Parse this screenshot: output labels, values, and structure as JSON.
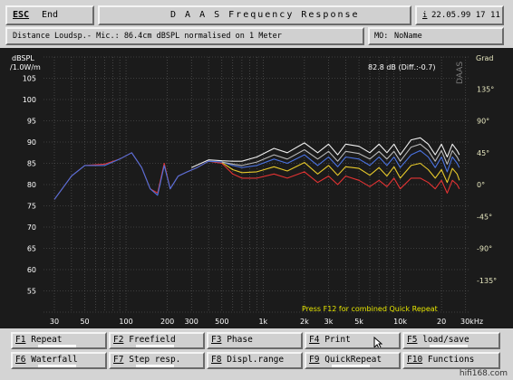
{
  "header": {
    "esc_key": "ESC",
    "esc_label": "End",
    "title": "D A A S   Frequency Response",
    "info_icon": "i",
    "datetime": "22.05.99 17 11"
  },
  "subheader": {
    "description": "Distance Loudsp.- Mic.: 86.4cm dBSPL normalised on 1 Meter",
    "mo_label": "MO:",
    "mo_value": "NoName"
  },
  "plot": {
    "readout": "82.8 dB (Diff.:-0.7)",
    "brand_vertical": "DAAS",
    "hint": "Press F12 for combined Quick Repeat",
    "left_unit_1": "dBSPL",
    "left_unit_2": "/1.0W/m",
    "right_unit": "Grad",
    "x_unit": "30kHz",
    "colors": {
      "background": "#1b1b1b",
      "grid": "#606060",
      "axis_text": "#ffffff",
      "right_axis_text": "#e8e8c0",
      "hint_text": "#e6e600"
    }
  },
  "chart_data": {
    "type": "line",
    "xscale": "log",
    "xlim": [
      25,
      32000
    ],
    "ylim": [
      50,
      110
    ],
    "y2lim": [
      -180,
      180
    ],
    "grid": true,
    "x_ticks": [
      {
        "value": 30,
        "label": "30"
      },
      {
        "value": 50,
        "label": "50"
      },
      {
        "value": 100,
        "label": "100"
      },
      {
        "value": 200,
        "label": "200"
      },
      {
        "value": 300,
        "label": "300"
      },
      {
        "value": 500,
        "label": "500"
      },
      {
        "value": 1000,
        "label": "1k"
      },
      {
        "value": 2000,
        "label": "2k"
      },
      {
        "value": 3000,
        "label": "3k"
      },
      {
        "value": 5000,
        "label": "5k"
      },
      {
        "value": 10000,
        "label": "10k"
      },
      {
        "value": 20000,
        "label": "20"
      }
    ],
    "y_ticks": [
      55,
      60,
      65,
      70,
      75,
      80,
      85,
      90,
      95,
      100,
      105
    ],
    "y2_ticks": [
      {
        "value": 135,
        "label": "135°"
      },
      {
        "value": 90,
        "label": "90°"
      },
      {
        "value": 45,
        "label": "45°"
      },
      {
        "value": 0,
        "label": "0°"
      },
      {
        "value": -45,
        "label": "-45°"
      },
      {
        "value": -90,
        "label": "-90°"
      },
      {
        "value": -135,
        "label": "-135°"
      }
    ],
    "series": [
      {
        "color": "#e33333",
        "points": [
          [
            30,
            76.5
          ],
          [
            40,
            82
          ],
          [
            50,
            84.5
          ],
          [
            70,
            84.8
          ],
          [
            90,
            86
          ],
          [
            110,
            87.5
          ],
          [
            130,
            84
          ],
          [
            150,
            79
          ],
          [
            170,
            78
          ],
          [
            190,
            85
          ],
          [
            210,
            79
          ],
          [
            240,
            82
          ],
          [
            280,
            83
          ],
          [
            330,
            84
          ],
          [
            400,
            85.5
          ],
          [
            500,
            85
          ],
          [
            600,
            82.5
          ],
          [
            700,
            81.5
          ],
          [
            900,
            81.5
          ],
          [
            1200,
            82.5
          ],
          [
            1500,
            81.5
          ],
          [
            2000,
            83
          ],
          [
            2500,
            80.5
          ],
          [
            3000,
            82
          ],
          [
            3500,
            80
          ],
          [
            4000,
            82
          ],
          [
            5000,
            81
          ],
          [
            6000,
            79.5
          ],
          [
            7000,
            81
          ],
          [
            8000,
            79.5
          ],
          [
            9000,
            81.5
          ],
          [
            10000,
            79
          ],
          [
            12000,
            81.5
          ],
          [
            14000,
            81.5
          ],
          [
            16000,
            80.5
          ],
          [
            18000,
            79
          ],
          [
            20000,
            81
          ],
          [
            22000,
            78
          ],
          [
            24000,
            81
          ],
          [
            26000,
            80
          ],
          [
            27000,
            79
          ]
        ]
      },
      {
        "color": "#e6c82a",
        "points": [
          [
            500,
            85.2
          ],
          [
            600,
            83.5
          ],
          [
            700,
            82.8
          ],
          [
            900,
            83
          ],
          [
            1200,
            84.2
          ],
          [
            1500,
            83.2
          ],
          [
            2000,
            85.2
          ],
          [
            2500,
            82.5
          ],
          [
            3000,
            84.5
          ],
          [
            3500,
            82.2
          ],
          [
            4000,
            84.2
          ],
          [
            5000,
            83.8
          ],
          [
            6000,
            82.2
          ],
          [
            7000,
            84
          ],
          [
            8000,
            82
          ],
          [
            9000,
            84.2
          ],
          [
            10000,
            81.5
          ],
          [
            12000,
            84.5
          ],
          [
            14000,
            85
          ],
          [
            16000,
            83.5
          ],
          [
            18000,
            81.5
          ],
          [
            20000,
            83.5
          ],
          [
            22000,
            80.5
          ],
          [
            24000,
            83.8
          ],
          [
            26000,
            82.5
          ],
          [
            27000,
            81
          ]
        ]
      },
      {
        "color": "#4a72e0",
        "points": [
          [
            30,
            76.5
          ],
          [
            40,
            82
          ],
          [
            50,
            84.5
          ],
          [
            70,
            84.5
          ],
          [
            90,
            86
          ],
          [
            110,
            87.5
          ],
          [
            130,
            84
          ],
          [
            150,
            79
          ],
          [
            170,
            77.5
          ],
          [
            190,
            84.5
          ],
          [
            210,
            79
          ],
          [
            240,
            82
          ],
          [
            280,
            83
          ],
          [
            330,
            84
          ],
          [
            400,
            85.5
          ],
          [
            500,
            85.3
          ],
          [
            600,
            84.5
          ],
          [
            700,
            84
          ],
          [
            900,
            84.5
          ],
          [
            1200,
            86
          ],
          [
            1500,
            85
          ],
          [
            2000,
            87
          ],
          [
            2500,
            84.5
          ],
          [
            3000,
            86.5
          ],
          [
            3500,
            84.2
          ],
          [
            4000,
            86.5
          ],
          [
            5000,
            86
          ],
          [
            6000,
            84.5
          ],
          [
            7000,
            86.5
          ],
          [
            8000,
            84.5
          ],
          [
            9000,
            86.5
          ],
          [
            10000,
            84
          ],
          [
            12000,
            87
          ],
          [
            14000,
            88
          ],
          [
            16000,
            86.5
          ],
          [
            18000,
            84
          ],
          [
            20000,
            86.5
          ],
          [
            22000,
            83
          ],
          [
            24000,
            86.5
          ],
          [
            26000,
            85
          ],
          [
            27000,
            84
          ]
        ]
      },
      {
        "color": "#f0f0f0",
        "points": [
          [
            300,
            84
          ],
          [
            400,
            85.8
          ],
          [
            500,
            85.6
          ],
          [
            600,
            85.5
          ],
          [
            700,
            85.5
          ],
          [
            900,
            86.5
          ],
          [
            1200,
            88.5
          ],
          [
            1500,
            87.5
          ],
          [
            2000,
            89.8
          ],
          [
            2500,
            87.5
          ],
          [
            3000,
            89.5
          ],
          [
            3500,
            87
          ],
          [
            4000,
            89.5
          ],
          [
            5000,
            89
          ],
          [
            6000,
            87.5
          ],
          [
            7000,
            89.5
          ],
          [
            8000,
            87.5
          ],
          [
            9000,
            89.5
          ],
          [
            10000,
            87
          ],
          [
            12000,
            90.5
          ],
          [
            14000,
            91
          ],
          [
            16000,
            89.5
          ],
          [
            18000,
            87
          ],
          [
            20000,
            89.5
          ],
          [
            22000,
            86.5
          ],
          [
            24000,
            89.5
          ],
          [
            26000,
            88
          ],
          [
            27000,
            87
          ]
        ]
      },
      {
        "color": "#b8b8b8",
        "points": [
          [
            500,
            85.3
          ],
          [
            600,
            84.8
          ],
          [
            700,
            84.5
          ],
          [
            900,
            85.3
          ],
          [
            1200,
            87
          ],
          [
            1500,
            86
          ],
          [
            2000,
            88.2
          ],
          [
            2500,
            86
          ],
          [
            3000,
            87.8
          ],
          [
            3500,
            85.5
          ],
          [
            4000,
            87.8
          ],
          [
            5000,
            87.3
          ],
          [
            6000,
            86
          ],
          [
            7000,
            87.8
          ],
          [
            8000,
            86
          ],
          [
            9000,
            87.8
          ],
          [
            10000,
            85.5
          ],
          [
            12000,
            88.8
          ],
          [
            14000,
            89.5
          ],
          [
            16000,
            88
          ],
          [
            18000,
            85.5
          ],
          [
            20000,
            88
          ],
          [
            22000,
            84.8
          ],
          [
            24000,
            88
          ],
          [
            26000,
            86.5
          ],
          [
            27000,
            85.5
          ]
        ]
      }
    ]
  },
  "fkeys": {
    "f1": {
      "key": "F1",
      "label": "Repeat"
    },
    "f2": {
      "key": "F2",
      "label": "Freefield"
    },
    "f3": {
      "key": "F3",
      "label": "Phase"
    },
    "f4": {
      "key": "F4",
      "label": "Print"
    },
    "f5": {
      "key": "F5",
      "label": "load/save"
    },
    "f6": {
      "key": "F6",
      "label": "Waterfall"
    },
    "f7": {
      "key": "F7",
      "label": "Step resp."
    },
    "f8": {
      "key": "F8",
      "label": "Displ.range"
    },
    "f9": {
      "key": "F9",
      "label": "QuickRepeat"
    },
    "f10": {
      "key": "F10",
      "label": "Functions"
    }
  },
  "watermark": "hifi168.com"
}
